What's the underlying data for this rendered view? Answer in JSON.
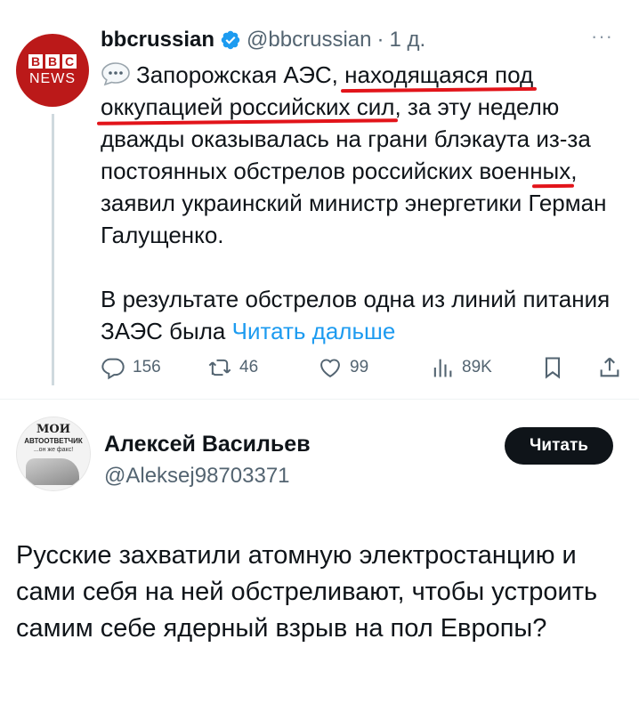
{
  "tweet": {
    "avatar": {
      "line1": "BBC",
      "line2": "NEWS"
    },
    "display_name": "bbcrussian",
    "verified_icon": "verified-badge-icon",
    "handle": "@bbcrussian",
    "separator_dot": "·",
    "time": "1 д.",
    "more_icon": "···",
    "text": {
      "intro": "Запорожская АЭС, ",
      "u1": "находящаяся под",
      "u2": "оккупацией российских сил",
      "mid1": ", за эту неделю дважды оказывалась на грани блэкаута ",
      "u3": "из-за постоянных обстрелов российских военных",
      "tail": ", заявил украинский министр энергетики Герман Галущенко.",
      "para2": "В результате обстрелов одна из линий питания ЗАЭС была ",
      "read_more": "Читать дальше"
    },
    "actions": {
      "replies": "156",
      "retweets": "46",
      "likes": "99",
      "views": "89K"
    }
  },
  "reply": {
    "avatar": {
      "line1": "МОИ",
      "line2": "АВТООТВЕТЧИК",
      "line3": "...он же факс!"
    },
    "display_name": "Алексей Васильев",
    "handle": "@Aleksej98703371",
    "follow_label": "Читать",
    "text": "Русские захватили атомную электростанцию и сами себя на ней обстреливают, чтобы устроить самим себе ядерный взрыв на пол Европы?"
  },
  "colors": {
    "link": "#1d9bf0",
    "underline_annotation": "#e2141a",
    "bbc_red": "#bb1919",
    "secondary_text": "#536471"
  }
}
